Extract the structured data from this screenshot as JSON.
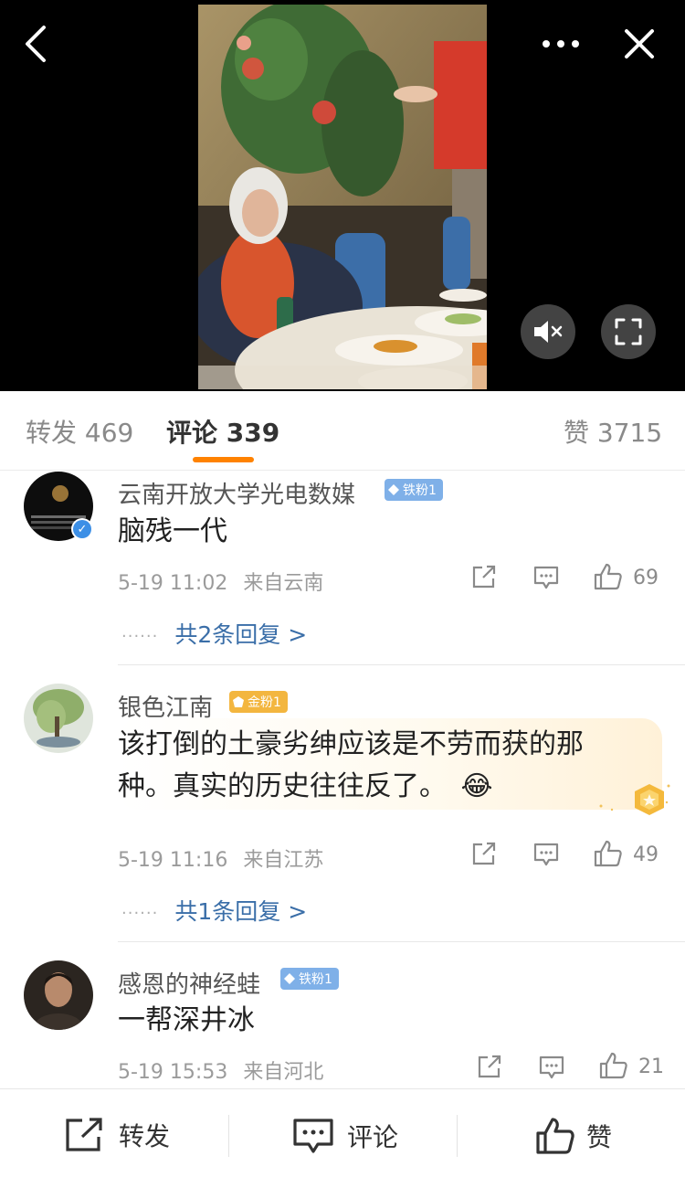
{
  "tabs": {
    "repost": "转发 469",
    "comments": "评论 339",
    "likes": "赞 3715"
  },
  "comments": [
    {
      "username": "云南开放大学光电数媒",
      "badge": "铁粉1",
      "text": "脑残一代",
      "time": "5-19 11:02",
      "location": "来自云南",
      "likes": "69",
      "replies": "共2条回复 >"
    },
    {
      "username": "银色江南",
      "badge": "金粉1",
      "text": "该打倒的土豪劣绅应该是不劳而获的那种。真实的历史往往反了。",
      "emoji": "😂",
      "time": "5-19 11:16",
      "location": "来自江苏",
      "likes": "49",
      "replies": "共1条回复 >"
    },
    {
      "username": "感恩的神经蛙",
      "badge": "铁粉1",
      "text": "一帮深井冰",
      "time": "5-19 15:53",
      "location": "来自河北",
      "likes": "21"
    }
  ],
  "bottom_bar": {
    "repost": "转发",
    "comment": "评论",
    "like": "赞"
  },
  "colors": {
    "accent": "#ff8200",
    "reply_link": "#3a6ea8",
    "iron_badge": "#7fb0e8",
    "gold_badge": "#f3b63f",
    "verified": "#3c8fe6"
  },
  "icons": [
    "back-icon",
    "more-icon",
    "close-icon",
    "mute-icon",
    "fullscreen-icon",
    "share-icon",
    "comment-icon",
    "like-icon",
    "verified-icon",
    "diamond-icon"
  ]
}
